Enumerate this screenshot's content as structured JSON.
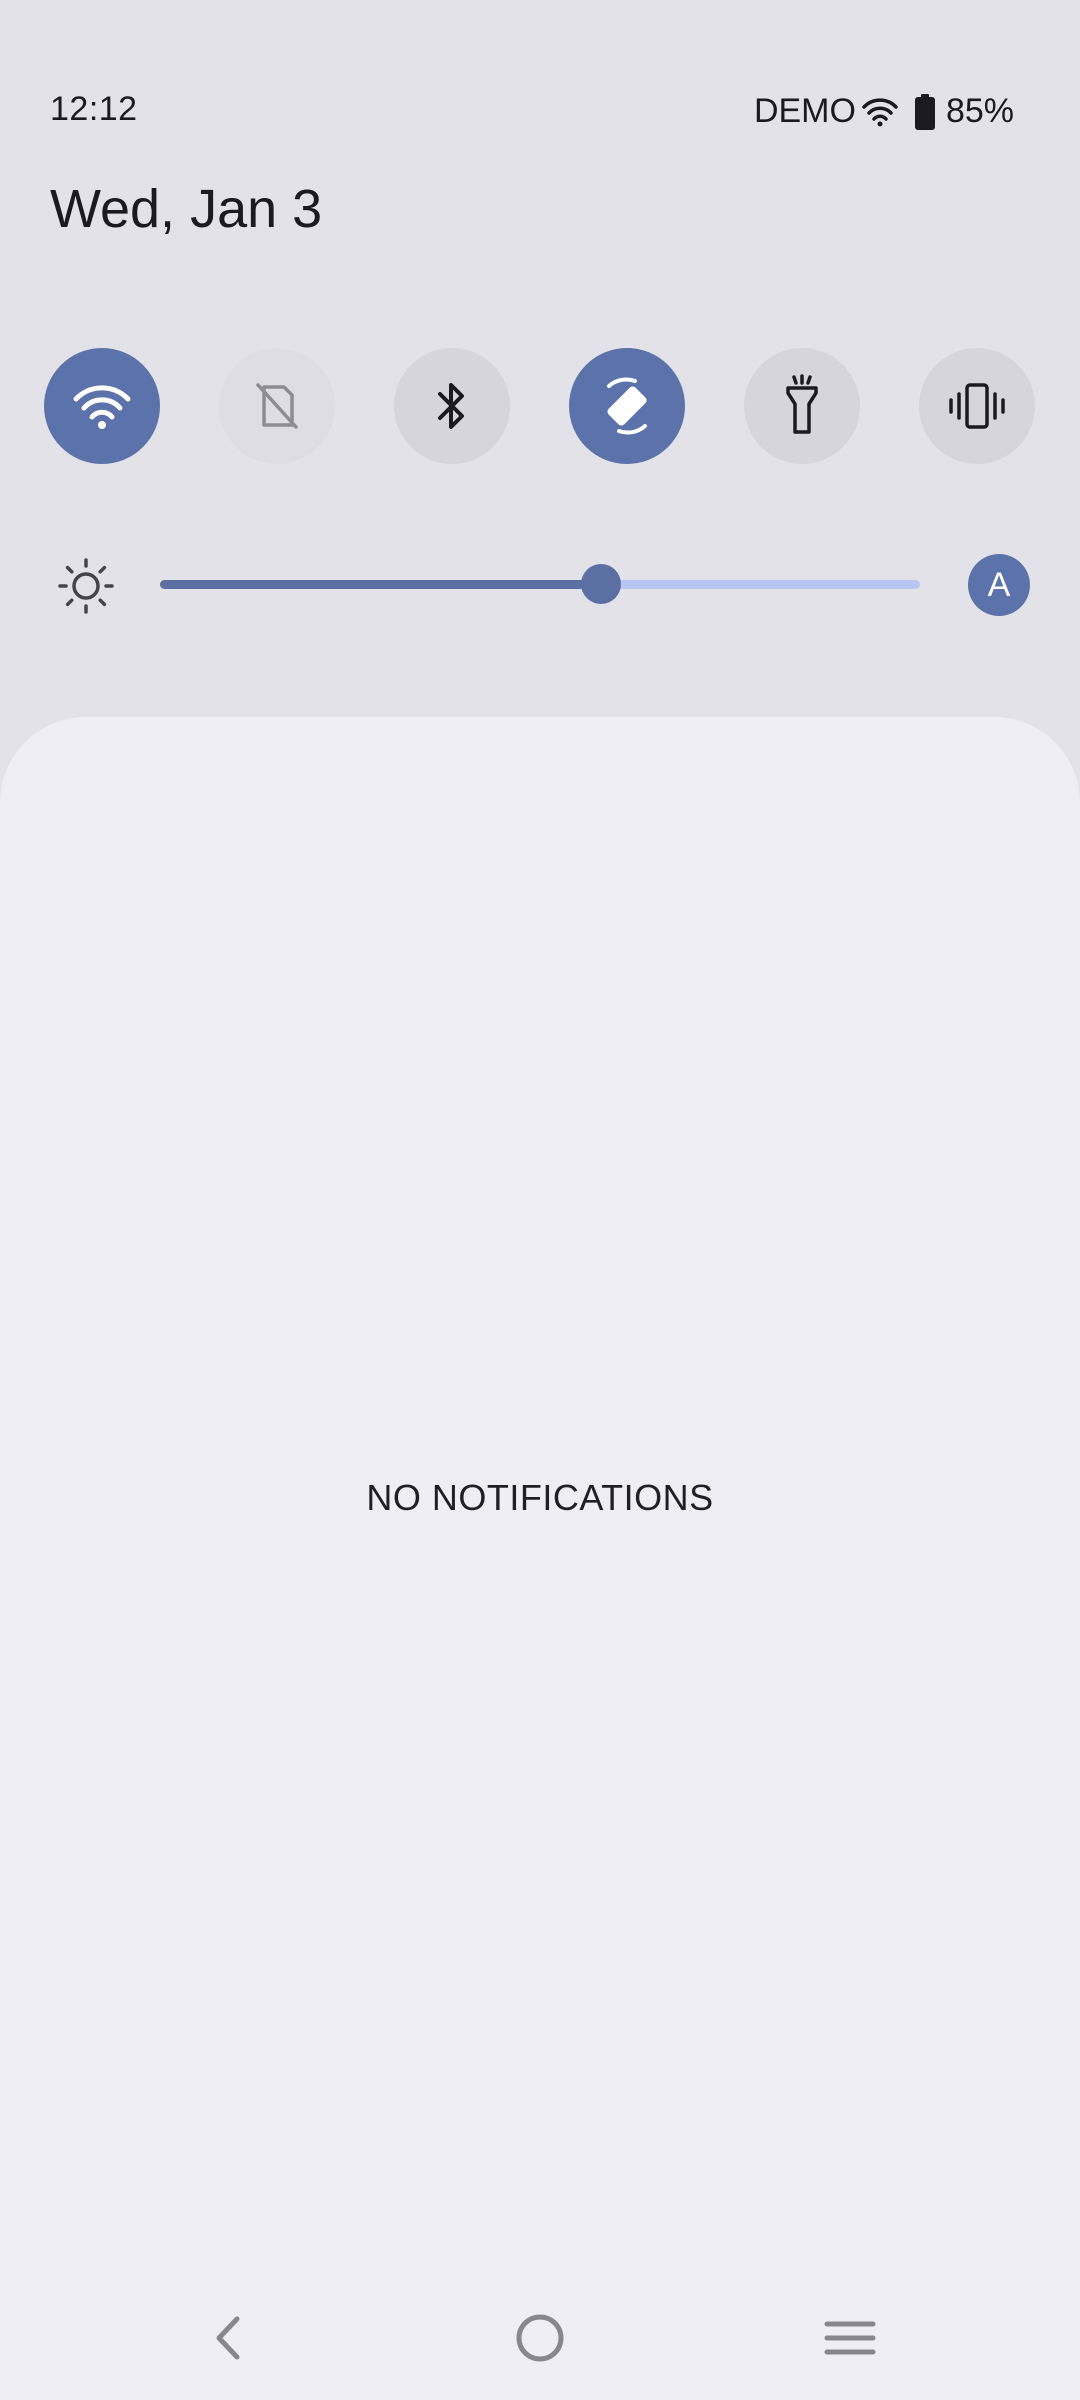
{
  "status_bar": {
    "time": "12:12",
    "carrier": "DEMO",
    "battery": "85%",
    "icons": [
      "wifi-icon",
      "battery-icon"
    ]
  },
  "header": {
    "date": "Wed, Jan 3"
  },
  "quick_settings": {
    "tiles": [
      {
        "name": "wifi",
        "icon": "wifi-icon",
        "state": "on"
      },
      {
        "name": "mobile-data",
        "icon": "no-sim-icon",
        "state": "unavailable"
      },
      {
        "name": "bluetooth",
        "icon": "bluetooth-icon",
        "state": "off"
      },
      {
        "name": "auto-rotate",
        "icon": "screen-rotation-icon",
        "state": "on"
      },
      {
        "name": "flashlight",
        "icon": "flashlight-icon",
        "state": "off"
      },
      {
        "name": "vibrate",
        "icon": "vibrate-icon",
        "state": "off"
      }
    ],
    "brightness": {
      "icon": "brightness-icon",
      "level": 0.58,
      "auto_label": "A"
    }
  },
  "notifications": {
    "empty_label": "NO NOTIFICATIONS"
  },
  "nav_bar": {
    "buttons": [
      "back-icon",
      "home-icon",
      "recents-icon"
    ]
  },
  "colors": {
    "accent": "#5b73aa",
    "background": "#e3e2e8",
    "panel": "#f0eef5",
    "slider_inactive": "#b9c6f4"
  }
}
